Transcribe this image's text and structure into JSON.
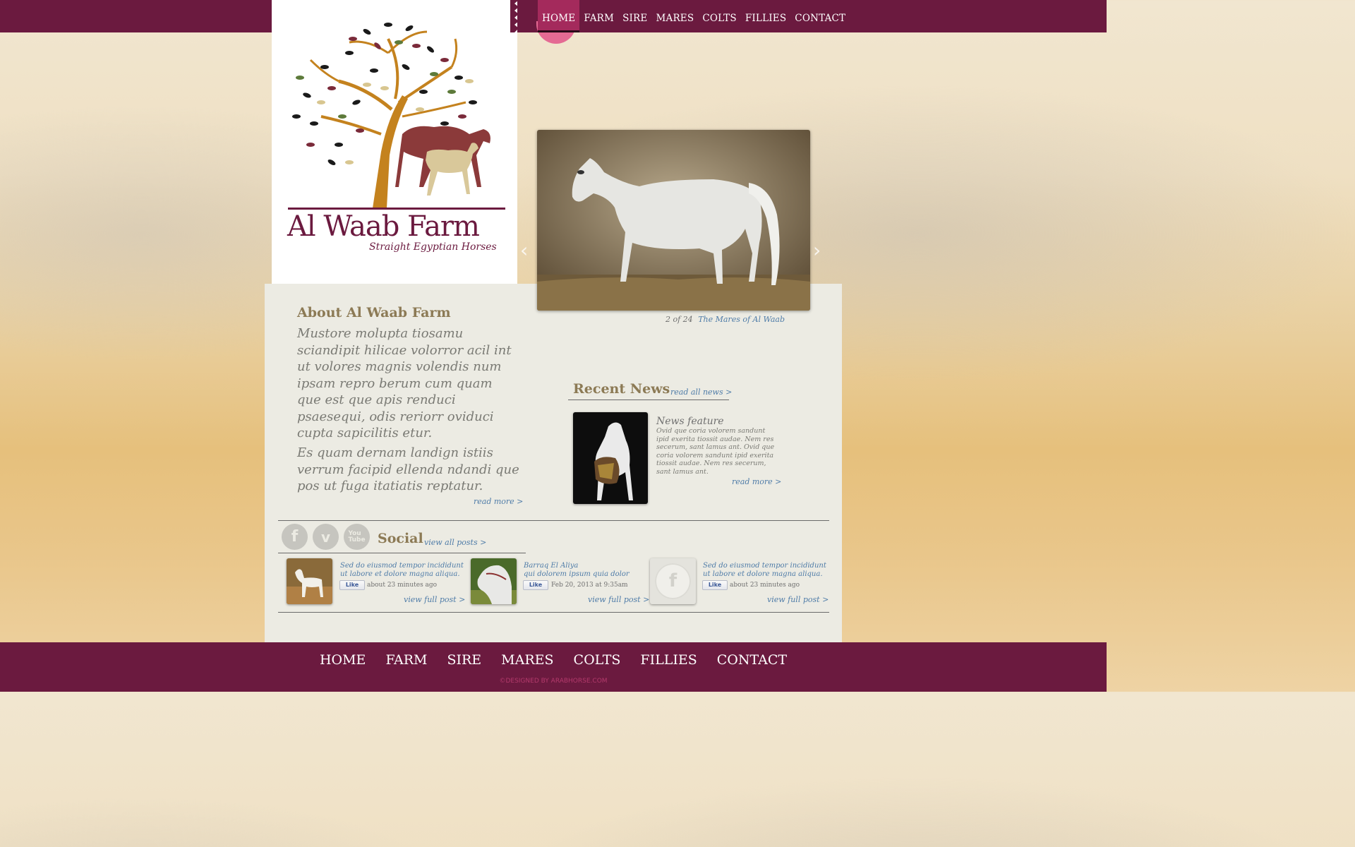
{
  "nav": {
    "top": [
      "HOME",
      "FARM",
      "SIRE",
      "MARES",
      "COLTS",
      "FILLIES",
      "CONTACT"
    ],
    "active": "HOME",
    "bottom": [
      "HOME",
      "FARM",
      "SIRE",
      "MARES",
      "COLTS",
      "FILLIES",
      "CONTACT"
    ]
  },
  "logo": {
    "title": "Al Waab Farm",
    "subtitle": "Straight Egyptian Horses"
  },
  "slideshow": {
    "counter": "2 of 24",
    "caption": "The Mares of Al Waab"
  },
  "about": {
    "title": "About Al Waab Farm",
    "p1": "Mustore molupta tiosamu sciandipit hilicae volorror acil int ut volores magnis volendis num ipsam repro berum cum quam que est que apis renduci psaesequi, odis reriorr oviduci cupta sapicilitis etur.",
    "p2": "Es quam dernam landign istiis verrum facipid ellenda ndandi que pos ut fuga itatiatis reptatur.",
    "read_more": "read more >"
  },
  "news": {
    "title": "Recent News",
    "read_all": "read all news >",
    "item": {
      "heading": "News feature",
      "body": "Ovid que coria volorem sandunt ipid exerita tiossit audae. Nem res secerum, sant lamus ant. Ovid que coria volorem sandunt ipid exerita tiossit audae. Nem res secerum, sant lamus ant.",
      "read_more": "read more >"
    }
  },
  "social": {
    "title": "Social",
    "view_all": "view all posts >",
    "icons": [
      "facebook-icon",
      "vimeo-icon",
      "youtube-icon"
    ],
    "posts": [
      {
        "text": "Sed do eiusmod tempor incididunt ut labore et dolore magna aliqua.",
        "like": "Like",
        "time": "about 23 minutes ago",
        "link": "view full post >"
      },
      {
        "text_line1": "Barraq El Aliya",
        "text_line2": "qui dolorem ipsum quia dolor",
        "like": "Like",
        "time": "Feb 20, 2013 at 9:35am",
        "link": "view full post >"
      },
      {
        "text": "Sed do eiusmod tempor incididunt ut labore et dolore magna aliqua.",
        "like": "Like",
        "time": "about 23 minutes ago",
        "link": "view full post >"
      }
    ]
  },
  "footer": {
    "copyright": "©DESIGNED BY ARABHORSE.COM"
  },
  "colors": {
    "brand": "#6b1a3f",
    "active_tab": "#a42a5c",
    "heading": "#8c7a55",
    "link": "#4f7ca8"
  }
}
